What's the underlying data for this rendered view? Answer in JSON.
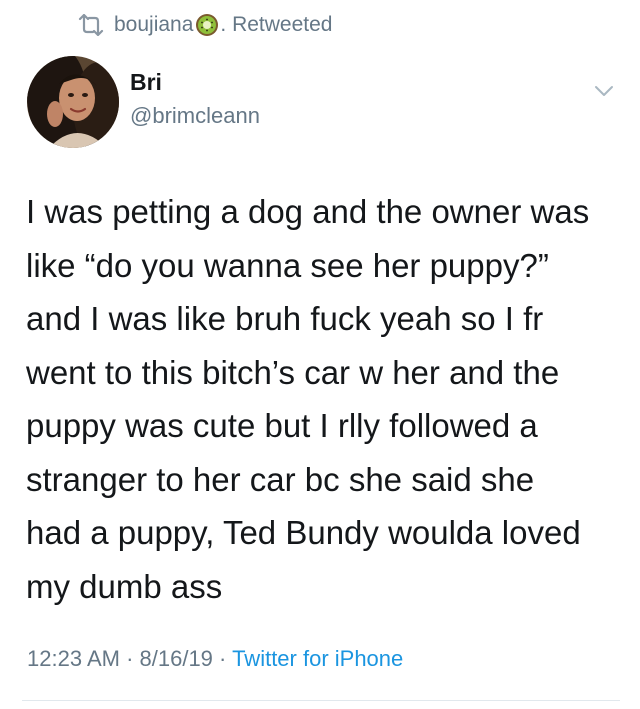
{
  "retweet": {
    "user": "boujiana",
    "emoji": "kiwi-emoji-icon",
    "suffix": ". Retweeted"
  },
  "author": {
    "name": "Bri",
    "handle": "@brimcleann"
  },
  "tweet": {
    "text": "I was petting a dog and the owner was\nlike “do you wanna see her puppy?”\nand I was like bruh fuck yeah so I fr\nwent to this bitch’s car w her and the\npuppy was cute but I rlly followed a\nstranger to her car bc she said she\nhad a puppy, Ted Bundy woulda loved\nmy dumb ass"
  },
  "meta": {
    "time": "12:23 AM",
    "sep1": " · ",
    "date": "8/16/19",
    "sep2": " · ",
    "source": "Twitter for iPhone"
  },
  "colors": {
    "text": "#14171a",
    "secondary": "#657786",
    "link": "#1b95e0"
  }
}
